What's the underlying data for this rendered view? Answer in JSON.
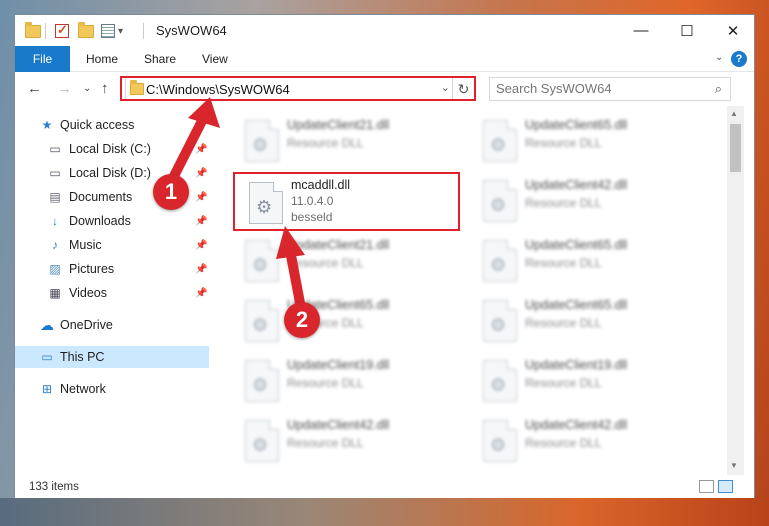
{
  "window": {
    "title": "SysWOW64",
    "controls": {
      "minimize": "—",
      "maximize": "☐",
      "close": "✕"
    }
  },
  "ribbon": {
    "tabs": [
      "File",
      "Home",
      "Share",
      "View"
    ],
    "help": "?"
  },
  "navigation": {
    "address": "C:\\Windows\\SysWOW64",
    "search_placeholder": "Search SysWOW64"
  },
  "sidebar": {
    "items": [
      {
        "label": "Quick access",
        "icon": "star-icon"
      },
      {
        "label": "Local Disk (C:)",
        "icon": "drive-icon",
        "pinned": true
      },
      {
        "label": "Local Disk (D:)",
        "icon": "drive-icon",
        "pinned": true
      },
      {
        "label": "Documents",
        "icon": "documents-icon",
        "pinned": true
      },
      {
        "label": "Downloads",
        "icon": "download-icon",
        "pinned": true
      },
      {
        "label": "Music",
        "icon": "music-icon",
        "pinned": true
      },
      {
        "label": "Pictures",
        "icon": "pictures-icon",
        "pinned": true
      },
      {
        "label": "Videos",
        "icon": "videos-icon",
        "pinned": true
      },
      {
        "label": "OneDrive",
        "icon": "cloud-icon"
      },
      {
        "label": "This PC",
        "icon": "computer-icon",
        "selected": true
      },
      {
        "label": "Network",
        "icon": "network-icon"
      }
    ]
  },
  "files": {
    "left": [
      {
        "name": "UpdateClient21.dll",
        "type": "Resource DLL",
        "blurred": true
      },
      {
        "name": "mcaddll.dll",
        "version": "11.0.4.0",
        "company": "besseld",
        "blurred": false
      },
      {
        "name": "UpdateClient21.dll",
        "type": "Resource DLL",
        "blurred": true
      },
      {
        "name": "UpdateClient65.dll",
        "type": "Resource DLL",
        "blurred": true
      },
      {
        "name": "UpdateClient19.dll",
        "type": "Resource DLL",
        "blurred": true
      },
      {
        "name": "UpdateClient42.dll",
        "type": "Resource DLL",
        "blurred": true
      }
    ],
    "right": [
      {
        "name": "UpdateClient65.dll",
        "type": "Resource DLL",
        "blurred": true
      },
      {
        "name": "UpdateClient42.dll",
        "type": "Resource DLL",
        "blurred": true
      },
      {
        "name": "UpdateClient65.dll",
        "type": "Resource DLL",
        "blurred": true
      },
      {
        "name": "UpdateClient65.dll",
        "type": "Resource DLL",
        "blurred": true
      },
      {
        "name": "UpdateClient19.dll",
        "type": "Resource DLL",
        "blurred": true
      },
      {
        "name": "UpdateClient42.dll",
        "type": "Resource DLL",
        "blurred": true
      }
    ]
  },
  "status": {
    "item_count": "133 items"
  },
  "annotations": {
    "step1": "1",
    "step2": "2"
  },
  "colors": {
    "accent": "#1979ca",
    "highlight": "#e0202a",
    "callout": "#d9262d",
    "selected": "#cce8ff"
  }
}
